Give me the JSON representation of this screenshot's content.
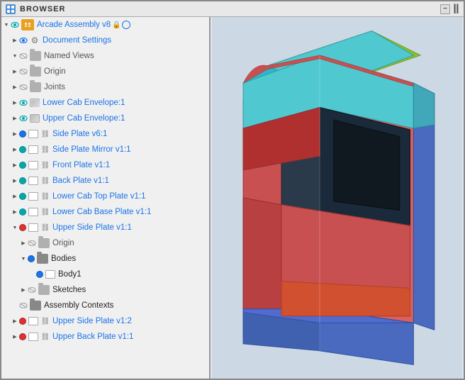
{
  "titlebar": {
    "label": "BROWSER",
    "icon": "B"
  },
  "root": {
    "label": "Arcade Assembly v8",
    "lock": "🔒",
    "circle": ""
  },
  "items": [
    {
      "id": "doc-settings",
      "indent": 1,
      "expand": "closed",
      "eye": "blue",
      "folder": "gray",
      "link": false,
      "label": "Document Settings",
      "labelColor": "blue"
    },
    {
      "id": "named-views",
      "indent": 1,
      "expand": "open",
      "eye": "hidden",
      "folder": "gray",
      "link": false,
      "label": "Named Views",
      "labelColor": "gray"
    },
    {
      "id": "origin",
      "indent": 1,
      "expand": "closed",
      "eye": "hidden",
      "folder": "gray",
      "link": false,
      "label": "Origin",
      "labelColor": "gray"
    },
    {
      "id": "joints",
      "indent": 1,
      "expand": "closed",
      "eye": "hidden",
      "folder": "gray",
      "link": false,
      "label": "Joints",
      "labelColor": "gray"
    },
    {
      "id": "lower-cab-env",
      "indent": 1,
      "expand": "closed",
      "eye": "teal",
      "folder": "envelope",
      "link": false,
      "label": "Lower Cab Envelope:1",
      "labelColor": "blue"
    },
    {
      "id": "upper-cab-env",
      "indent": 1,
      "expand": "closed",
      "eye": "teal",
      "folder": "envelope",
      "link": false,
      "label": "Upper Cab Envelope:1",
      "labelColor": "blue"
    },
    {
      "id": "side-plate",
      "indent": 1,
      "expand": "closed",
      "eye": "blue",
      "folder": "white",
      "link": true,
      "label": "Side Plate v6:1",
      "labelColor": "blue"
    },
    {
      "id": "side-plate-mirror",
      "indent": 1,
      "expand": "closed",
      "eye": "teal",
      "folder": "white",
      "link": true,
      "label": "Side Plate Mirror v1:1",
      "labelColor": "blue"
    },
    {
      "id": "front-plate",
      "indent": 1,
      "expand": "closed",
      "eye": "teal",
      "folder": "white",
      "link": true,
      "label": "Front Plate v1:1",
      "labelColor": "blue"
    },
    {
      "id": "back-plate",
      "indent": 1,
      "expand": "closed",
      "eye": "teal",
      "folder": "white",
      "link": true,
      "label": "Back Plate v1:1",
      "labelColor": "blue"
    },
    {
      "id": "lower-cab-top",
      "indent": 1,
      "expand": "closed",
      "eye": "teal",
      "folder": "white",
      "link": true,
      "label": "Lower Cab Top Plate v1:1",
      "labelColor": "blue"
    },
    {
      "id": "lower-cab-base",
      "indent": 1,
      "expand": "closed",
      "eye": "teal",
      "folder": "white",
      "link": true,
      "label": "Lower Cab Base Plate v1:1",
      "labelColor": "blue"
    },
    {
      "id": "upper-side-plate",
      "indent": 1,
      "expand": "open",
      "eye": "red",
      "folder": "white",
      "link": true,
      "label": "Upper Side Plate v1:1",
      "labelColor": "blue"
    },
    {
      "id": "origin-sub",
      "indent": 2,
      "expand": "closed",
      "eye": "hidden",
      "folder": "gray",
      "link": false,
      "label": "Origin",
      "labelColor": "gray"
    },
    {
      "id": "bodies",
      "indent": 2,
      "expand": "open",
      "eye": "blue",
      "folder": "dark-gray",
      "link": false,
      "label": "Bodies",
      "labelColor": "black"
    },
    {
      "id": "body1",
      "indent": 3,
      "expand": "empty",
      "eye": "blue",
      "folder": "white-sm",
      "link": false,
      "label": "Body1",
      "labelColor": "black"
    },
    {
      "id": "sketches",
      "indent": 2,
      "expand": "closed",
      "eye": "hidden",
      "folder": "gray",
      "link": false,
      "label": "Sketches",
      "labelColor": "black"
    },
    {
      "id": "asm-contexts",
      "indent": 1,
      "expand": "empty",
      "eye": "hidden",
      "folder": "dark-gray",
      "link": false,
      "label": "Assembly Contexts",
      "labelColor": "black"
    },
    {
      "id": "upper-side-plate-2",
      "indent": 1,
      "expand": "closed",
      "eye": "red",
      "folder": "white",
      "link": true,
      "label": "Upper Side Plate v1:2",
      "labelColor": "blue"
    },
    {
      "id": "upper-back-plate",
      "indent": 1,
      "expand": "closed",
      "eye": "red",
      "folder": "white",
      "link": true,
      "label": "Upper Back Plate v1:1",
      "labelColor": "blue"
    }
  ],
  "viewport": {
    "bg_color": "#ccd8e0"
  }
}
